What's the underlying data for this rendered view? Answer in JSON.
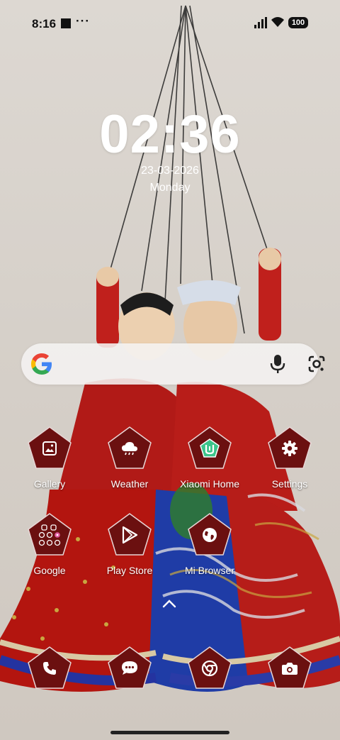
{
  "status_bar": {
    "time": "8:16",
    "more": "···",
    "battery": "100"
  },
  "clock": {
    "time": "02:36",
    "date": "23-03-2026",
    "day": "Monday"
  },
  "search": {
    "engine": "Google"
  },
  "apps": {
    "row1": [
      {
        "label": "Gallery",
        "icon": "gallery-icon"
      },
      {
        "label": "Weather",
        "icon": "weather-icon"
      },
      {
        "label": "Xiaomi Home",
        "icon": "xiaomi-home-icon"
      },
      {
        "label": "Settings",
        "icon": "settings-icon"
      }
    ],
    "row2": [
      {
        "label": "Google",
        "icon": "google-folder-icon"
      },
      {
        "label": "Play Store",
        "icon": "play-store-icon"
      },
      {
        "label": "Mi Browser",
        "icon": "globe-icon"
      }
    ]
  },
  "dock": [
    {
      "icon": "phone-icon"
    },
    {
      "icon": "messages-icon"
    },
    {
      "icon": "chrome-icon"
    },
    {
      "icon": "camera-icon"
    }
  ],
  "colors": {
    "icon_bg": "#6b1010",
    "icon_border": "#e8d6d6",
    "accent_green": "#3cc48a"
  }
}
